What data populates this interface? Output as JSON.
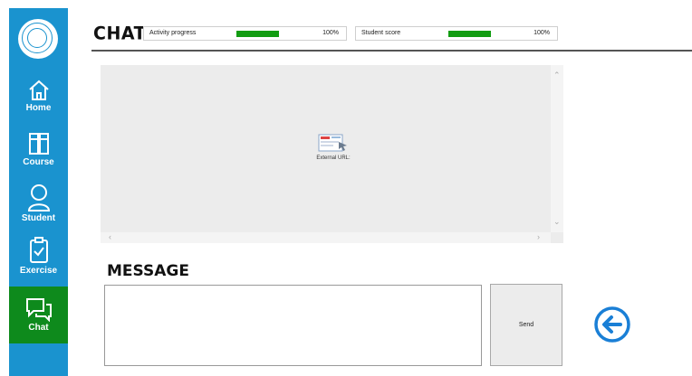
{
  "sidebar": {
    "items": [
      {
        "label": "Home",
        "icon": "home-icon"
      },
      {
        "label": "Course",
        "icon": "books-icon"
      },
      {
        "label": "Student",
        "icon": "user-icon"
      },
      {
        "label": "Exercise",
        "icon": "clipboard-check-icon"
      },
      {
        "label": "Chat",
        "icon": "chat-icon",
        "active": true
      }
    ]
  },
  "header": {
    "title": "Chat",
    "activity_progress": {
      "label": "Activity progress",
      "value_text": "100%",
      "fraction": 1.0
    },
    "student_score": {
      "label": "Student score",
      "value_text": "100%",
      "fraction": 1.0
    }
  },
  "frame": {
    "caption": "External URL:"
  },
  "message": {
    "title": "Message",
    "input_value": "",
    "send_label": "Send"
  },
  "colors": {
    "sidebar": "#1a93cf",
    "active": "#0e8a1c",
    "progress": "#129c12",
    "back_button": "#1a7fd6"
  }
}
